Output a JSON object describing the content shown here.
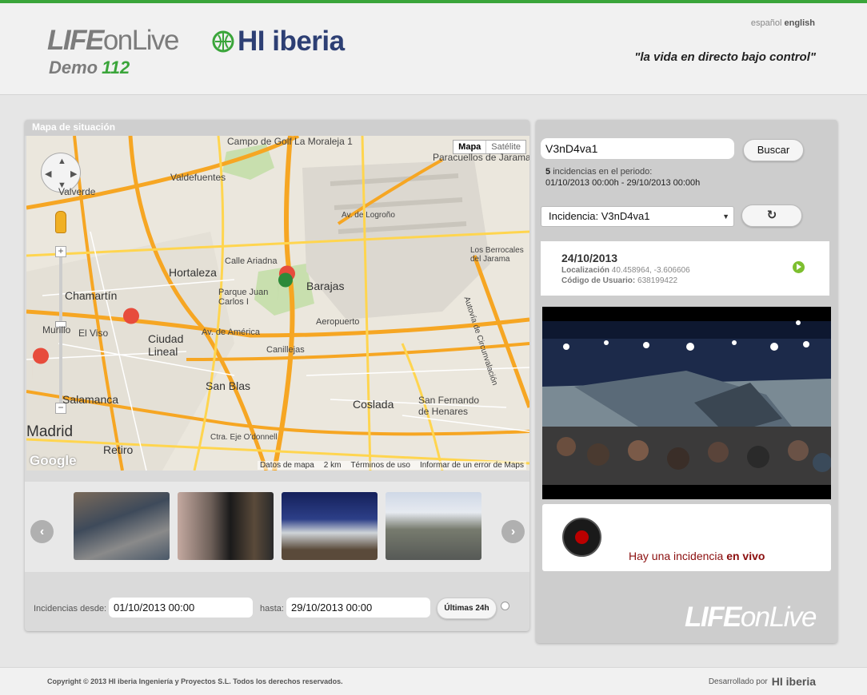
{
  "header": {
    "brand_life": "LIFE",
    "brand_onlive": "onLive",
    "demo_label": "Demo",
    "demo_number": "112",
    "hi_brand": "HI iberia",
    "lang_es": "español",
    "lang_en": "english",
    "tagline": "\"la vida en directo bajo control\""
  },
  "map": {
    "title": "Mapa de situación",
    "type_map": "Mapa",
    "type_satellite": "Satélite",
    "footer_data": "Datos de mapa",
    "footer_scale": "2 km",
    "footer_terms": "Términos de uso",
    "footer_report": "Informar de un error de Maps",
    "google": "Google",
    "labels": {
      "alcobendas": "Campo de Golf La Moraleja 1",
      "valdefuentes": "Valdefuentes",
      "valverde": "Valverde",
      "paracuellos": "Paracuellos de Jarama",
      "av_logrono": "Av. de Logroño",
      "calle_ariadna": "Calle Ariadna",
      "hortaleza": "Hortaleza",
      "barajas": "Barajas",
      "parque_juan_carlos": "Parque Juan Carlos I",
      "los_berrocales": "Los Berrocales del Jarama",
      "chamartin": "Chamartín",
      "murillo": "Murillo",
      "el_viso": "El Viso",
      "ciudad_lineal": "Ciudad Lineal",
      "av_america": "Av. de América",
      "aeropuerto": "Aeropuerto",
      "canillejas": "Canillejas",
      "autovia": "Autovía de Circunvalación",
      "salamanca": "Salamanca",
      "san_blas": "San Blas",
      "coslada": "Coslada",
      "san_fernando": "San Fernando de Henares",
      "madrid": "Madrid",
      "retiro": "Retiro",
      "ctra_odonnell": "Ctra. Eje O'donnell"
    }
  },
  "filters": {
    "from_label": "Incidencias desde:",
    "from_value": "01/10/2013 00:00",
    "to_label": "hasta:",
    "to_value": "29/10/2013 00:00",
    "last24_label": "Últimas 24h"
  },
  "sidebar": {
    "search_value": "V3nD4va1",
    "search_button": "Buscar",
    "period_count": "5",
    "period_text": "incidencias en el periodo:",
    "period_range": "01/10/2013 00:00h - 29/10/2013 00:00h",
    "incident_select": "Incidencia: V3nD4va1",
    "incident": {
      "date": "24/10/2013",
      "loc_label": "Localización",
      "loc_value": "40.458964, -3.606606",
      "user_label": "Código de Usuario:",
      "user_value": "638199422"
    },
    "live_text": "Hay una incidencia",
    "live_strong": "en vivo",
    "brand_life": "LIFE",
    "brand_onlive": "onLive"
  },
  "footer": {
    "copyright": "Copyright © 2013 HI iberia Ingeniería y Proyectos S.L. Todos los derechos reservados.",
    "developed_by": "Desarrollado por",
    "dev_brand": "HI iberia"
  }
}
